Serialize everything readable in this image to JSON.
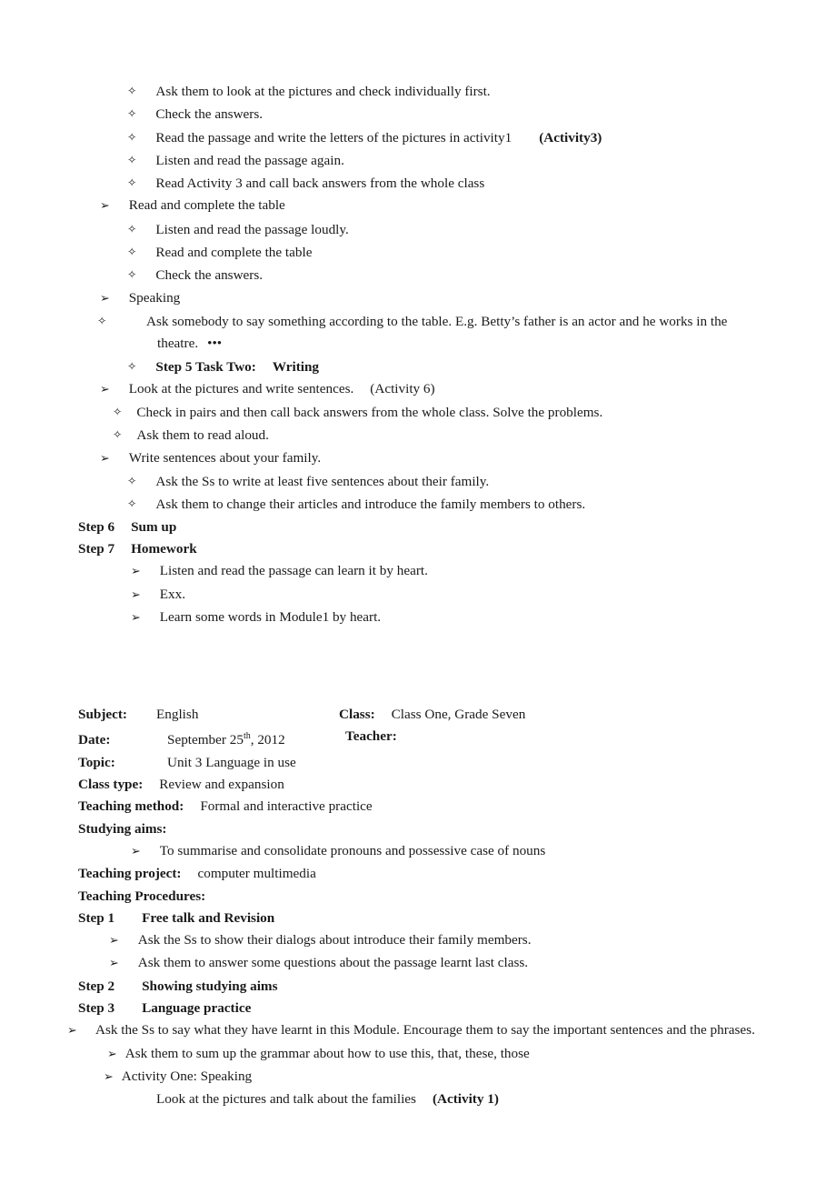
{
  "document": {
    "part1": {
      "bullets_group_a": [
        {
          "bullet": "diamond",
          "text": "Ask them to look at the pictures and check individually first."
        },
        {
          "bullet": "diamond",
          "text": "Check the answers."
        },
        {
          "bullet": "diamond",
          "text": "Read the passage and write the letters of the pictures in activity1",
          "tail_bold": "(Activity3)"
        },
        {
          "bullet": "diamond",
          "text": "Listen and read the passage again."
        },
        {
          "bullet": "diamond",
          "text": "Read Activity 3 and call back answers from the whole class"
        }
      ],
      "read_table_heading": "Read and complete the table",
      "bullets_group_b": [
        {
          "bullet": "diamond",
          "text": "Listen and read the passage loudly."
        },
        {
          "bullet": "diamond",
          "text": "Read and complete the table"
        },
        {
          "bullet": "diamond",
          "text": "Check the answers."
        }
      ],
      "speaking_heading": "Speaking",
      "speaking_detail": "Ask somebody to say something according to the table. E.g. Betty’s father is an actor and he works in the theatre.",
      "speaking_detail_mark": "•••",
      "step5_label": "Step 5 Task Two:",
      "step5_value": "Writing",
      "activity6_text": "Look at the pictures and write sentences.",
      "activity6_tag": "(Activity 6)",
      "bullets_group_c": [
        {
          "bullet": "diamond",
          "text": "Check in pairs and then call back answers from the whole class. Solve the problems."
        },
        {
          "bullet": "diamond",
          "text": "Ask them to read aloud."
        }
      ],
      "write_family_heading": "Write sentences about your family.",
      "bullets_group_d": [
        {
          "bullet": "diamond",
          "text": "Ask the Ss to write at least five sentences about their family."
        },
        {
          "bullet": "diamond",
          "text": "Ask them to change their articles and introduce the family members to others."
        }
      ],
      "step6_label": "Step 6",
      "step6_value": "Sum up",
      "step7_label": "Step 7",
      "step7_value": "Homework",
      "homework_items": [
        {
          "bullet": "arrow",
          "text": "Listen and read the passage can learn it by heart."
        },
        {
          "bullet": "arrow",
          "text": "Exx."
        },
        {
          "bullet": "arrow",
          "text": "Learn some words in Module1 by heart."
        }
      ]
    },
    "part2": {
      "header_fields": [
        {
          "label": "Subject:",
          "value": "English"
        },
        {
          "label": "Date:",
          "value": "September 25",
          "value_sup": "th",
          "value_tail": ", 2012"
        },
        {
          "label": "Topic:",
          "value": "Unit 3    Language in use"
        },
        {
          "label": "Class type:",
          "value": "Review and expansion"
        }
      ],
      "header_right": [
        {
          "label": "Class:",
          "value": "Class One, Grade Seven"
        },
        {
          "label": "Teacher:",
          "value": ""
        }
      ],
      "teaching_method_label": "Teaching method:",
      "teaching_method_value": "Formal and interactive practice",
      "studying_aims_label": "Studying aims:",
      "studying_aims_items": [
        {
          "bullet": "arrow",
          "text": "To summarise and consolidate pronouns and possessive case of nouns"
        }
      ],
      "teaching_project_label": "Teaching project:",
      "teaching_project_value": "computer    multimedia",
      "teaching_procedures_label": "Teaching Procedures:",
      "step1_label": "Step 1",
      "step1_value": "Free talk and Revision",
      "step1_items": [
        {
          "bullet": "arrow",
          "text": "Ask the Ss to show their dialogs about introduce their family members."
        },
        {
          "bullet": "arrow",
          "text": "Ask them to answer some questions about the passage learnt last class."
        }
      ],
      "step2_label": "Step 2",
      "step2_value": "Showing studying aims",
      "step3_label": "Step 3",
      "step3_value": "Language practice",
      "step3_items": [
        {
          "bullet": "arrow",
          "text": "Ask the Ss to say what they have learnt in this Module. Encourage them to say the important sentences and the phrases."
        },
        {
          "bullet": "arrow",
          "text": "Ask them to sum up the grammar about how to use this, that, these, those"
        },
        {
          "bullet": "arrow",
          "text": "Activity One: Speaking"
        }
      ],
      "activity1_text": "Look at the pictures and talk about the families",
      "activity1_tag": "(Activity 1)"
    }
  },
  "glyphs": {
    "diamond": "✧",
    "arrow": "➢"
  }
}
